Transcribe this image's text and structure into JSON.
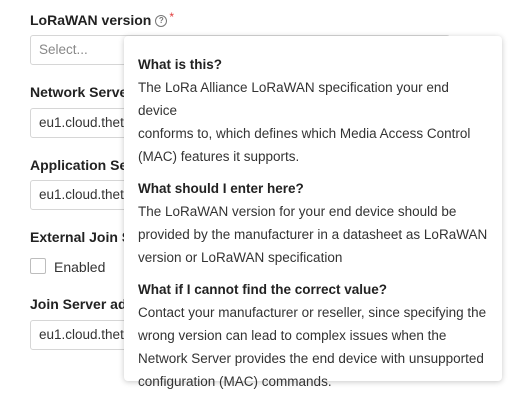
{
  "fields": {
    "lorawan_version": {
      "label": "LoRaWAN version",
      "help_icon": "question-circle-icon",
      "required_mark": "*",
      "placeholder": "Select..."
    },
    "network_server": {
      "label": "Network Server",
      "value": "eu1.cloud.thet"
    },
    "application_server": {
      "label": "Application Serv",
      "value": "eu1.cloud.thet"
    },
    "external_join": {
      "label": "External Join Se",
      "checkbox_label": "Enabled"
    },
    "join_server": {
      "label": "Join Server add",
      "value": "eu1.cloud.thet"
    }
  },
  "tooltip": {
    "sections": [
      {
        "heading": "What is this?",
        "lines": [
          "The LoRa Alliance LoRaWAN specification your end device",
          "conforms to, which defines which Media Access Control",
          "(MAC) features it supports."
        ]
      },
      {
        "heading": "What should I enter here?",
        "lines": [
          "The LoRaWAN version for your end device should be",
          "provided by the manufacturer in a datasheet as LoRaWAN",
          "version or LoRaWAN specification"
        ]
      },
      {
        "heading": "What if I cannot find the correct value?",
        "lines": [
          "Contact your manufacturer or reseller, since specifying the",
          "wrong version can lead to complex issues when the",
          "Network Server provides the end device with unsupported",
          "configuration (MAC) commands."
        ]
      }
    ]
  },
  "colors": {
    "required": "#e03c3c",
    "border": "#d6d6d6"
  }
}
